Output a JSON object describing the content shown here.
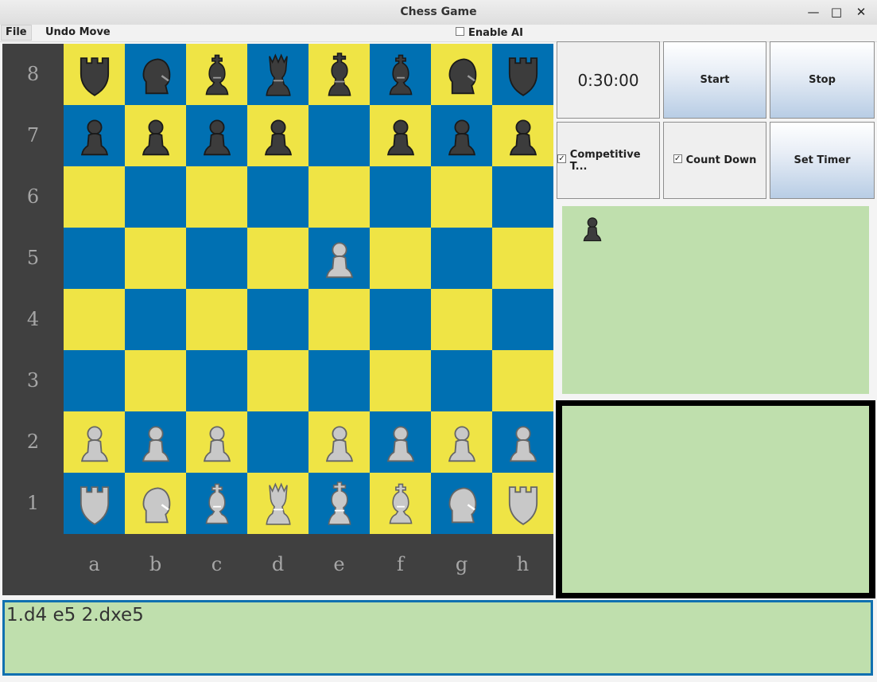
{
  "window": {
    "title": "Chess Game"
  },
  "menu": {
    "file": "File",
    "undo": "Undo Move",
    "enable_ai": "Enable AI"
  },
  "timer": {
    "display": "0:30:00",
    "start": "Start",
    "stop": "Stop",
    "competitive": "Competitive T...",
    "count_down": "Count Down",
    "set_timer": "Set Timer",
    "competitive_checked": true,
    "count_down_checked": true
  },
  "board": {
    "ranks": [
      "8",
      "7",
      "6",
      "5",
      "4",
      "3",
      "2",
      "1"
    ],
    "files": [
      "a",
      "b",
      "c",
      "d",
      "e",
      "f",
      "g",
      "h"
    ],
    "light_color": "#efe445",
    "dark_color": "#0070b2",
    "rows": [
      [
        "bR",
        "bN",
        "bB",
        "bQ",
        "bK",
        "bB",
        "bN",
        "bR"
      ],
      [
        "bP",
        "bP",
        "bP",
        "bP",
        "",
        "bP",
        "bP",
        "bP"
      ],
      [
        "",
        "",
        "",
        "",
        "",
        "",
        "",
        ""
      ],
      [
        "",
        "",
        "",
        "",
        "wP",
        "",
        "",
        ""
      ],
      [
        "",
        "",
        "",
        "",
        "",
        "",
        "",
        ""
      ],
      [
        "",
        "",
        "",
        "",
        "",
        "",
        "",
        ""
      ],
      [
        "wP",
        "wP",
        "wP",
        "",
        "wP",
        "wP",
        "wP",
        "wP"
      ],
      [
        "wR",
        "wN",
        "wB",
        "wQ",
        "wK",
        "wB",
        "wN",
        "wR"
      ]
    ]
  },
  "captured": {
    "by_white": [
      "bP"
    ],
    "by_black": []
  },
  "notation": "1.d4 e5 2.dxe5",
  "colors": {
    "panel_green": "#bfdfad",
    "notation_border": "#1070b0",
    "board_frame": "#404040"
  }
}
